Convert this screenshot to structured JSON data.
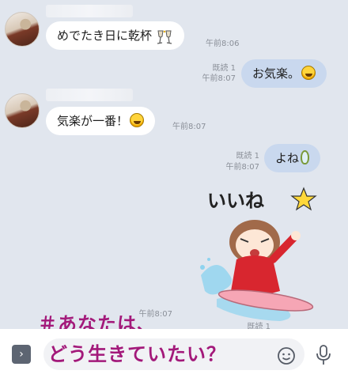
{
  "messages": [
    {
      "text": "めでたき日に乾杯",
      "icon": "cheers-icon",
      "time": "午前8:06"
    },
    {
      "text": "お気楽。",
      "icon": "laughing-emoji-icon",
      "read": "既読 1",
      "time": "午前8:07"
    },
    {
      "text": "気楽が一番！",
      "icon": "laughing-emoji-icon",
      "time": "午前8:07"
    },
    {
      "text": "よね",
      "icon": "balloon-icon",
      "read": "既読 1",
      "time": "午前8:07"
    },
    {
      "sticker_text": "いいね",
      "read": "既読 1",
      "time": "午前8:07"
    }
  ],
  "overlay": {
    "line1": "＃あなたは、",
    "line2": "どう生きていたい？"
  },
  "input": {
    "expand_label": "›"
  },
  "colors": {
    "background": "#e1e6ee",
    "outgoing": "#c9d8ee",
    "incoming": "#ffffff",
    "hashtag": "#a3197a"
  }
}
